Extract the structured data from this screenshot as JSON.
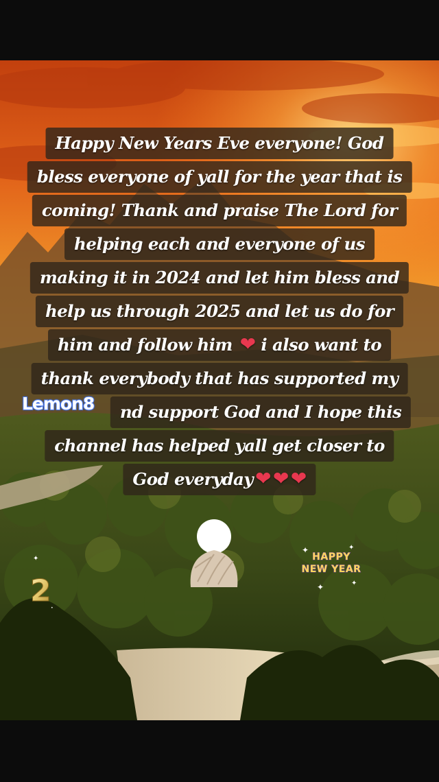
{
  "post": {
    "caption_lines": [
      "Happy New Years Eve everyone! God",
      "bless everyone of yall for the year that is",
      "coming! Thank and praise The Lord for",
      "helping each and everyone of us",
      "making it in 2024 and let him bless and",
      "help us through 2025 and let us do for",
      "him and follow him",
      "i also want to",
      "thank everybody that has supported my",
      "nd support God and I hope this",
      "channel has helped yall get closer to",
      "God everyday"
    ],
    "heart_glyph": "❤",
    "watermark": "Lemon8"
  },
  "stickers": {
    "number": "2",
    "hny_line1": "HAPPY",
    "hny_line2": "NEW YEAR"
  },
  "colors": {
    "sky_orange": "#e8701c",
    "sky_gold": "#f5b640",
    "caption_box": "#30261a",
    "caption_text": "#ffffff",
    "heart": "#e8384f",
    "watermark_stroke": "#4d7df0",
    "forest": "#2e3a14"
  }
}
